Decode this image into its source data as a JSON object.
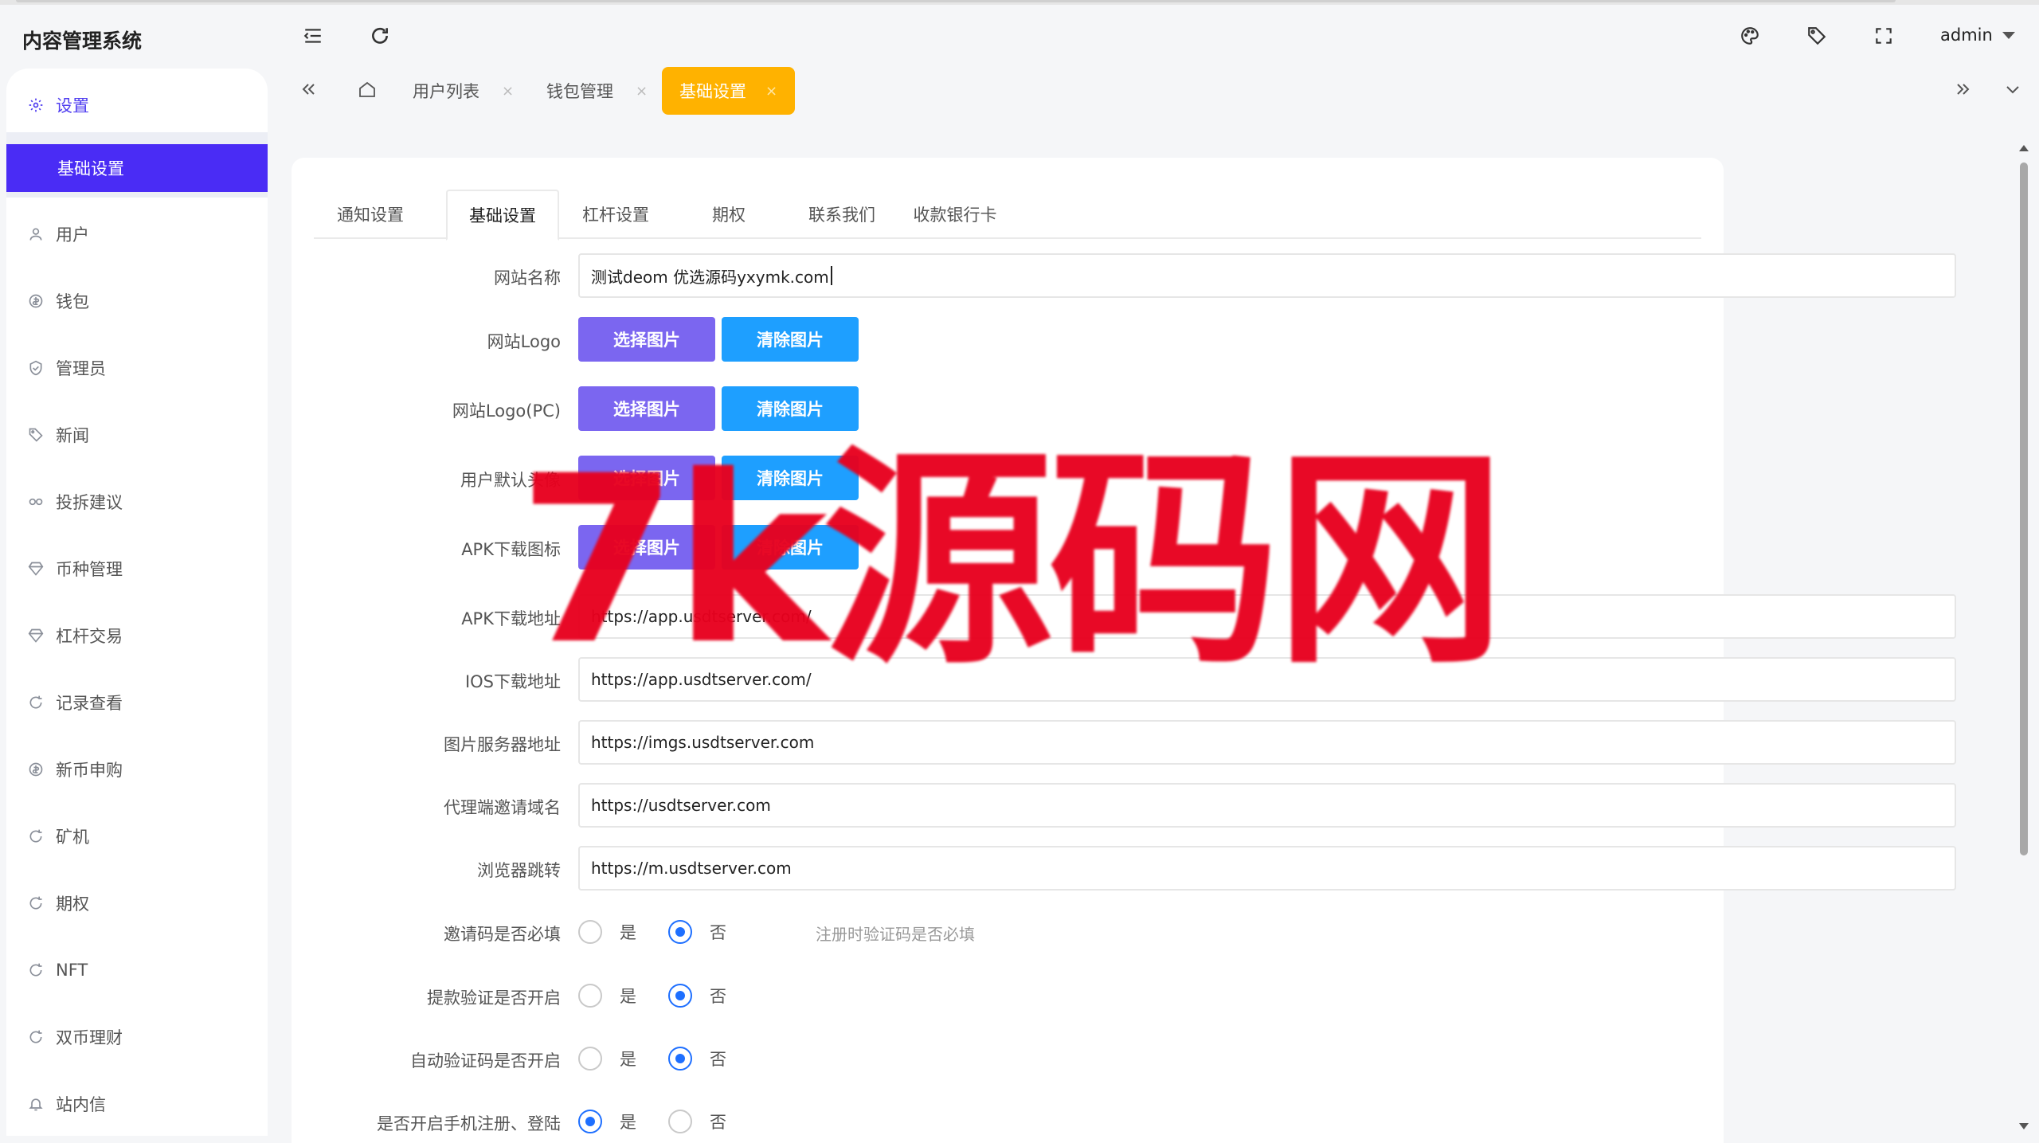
{
  "app": {
    "title": "内容管理系统",
    "user": "admin"
  },
  "sidebar": {
    "items": [
      {
        "label": "设置",
        "icon": "gear-icon"
      },
      {
        "label": "基础设置",
        "icon": ""
      },
      {
        "label": "用户",
        "icon": "user-icon"
      },
      {
        "label": "钱包",
        "icon": "dollar-icon"
      },
      {
        "label": "管理员",
        "icon": "shield-icon"
      },
      {
        "label": "新闻",
        "icon": "tag-icon"
      },
      {
        "label": "投拆建议",
        "icon": "link-icon"
      },
      {
        "label": "币种管理",
        "icon": "diamond-icon"
      },
      {
        "label": "杠杆交易",
        "icon": "diamond-icon"
      },
      {
        "label": "记录查看",
        "icon": "cycle-icon"
      },
      {
        "label": "新币申购",
        "icon": "dollar-icon"
      },
      {
        "label": "矿机",
        "icon": "cycle-icon"
      },
      {
        "label": "期权",
        "icon": "cycle-icon"
      },
      {
        "label": "NFT",
        "icon": "cycle-icon"
      },
      {
        "label": "双币理财",
        "icon": "cycle-icon"
      },
      {
        "label": "站内信",
        "icon": "bell-icon"
      }
    ]
  },
  "tabs": [
    {
      "label": "用户列表",
      "close": "×"
    },
    {
      "label": "钱包管理",
      "close": "×"
    },
    {
      "label": "基础设置",
      "close": "×"
    }
  ],
  "content_tabs": [
    "通知设置",
    "基础设置",
    "杠杆设置",
    "期权",
    "联系我们",
    "收款银行卡"
  ],
  "form": {
    "site_name_label": "网站名称",
    "site_name_value": "测试deom 优选源码yxymk.com",
    "logo_label": "网站Logo",
    "logo_pc_label": "网站Logo(PC)",
    "avatar_label": "用户默认头像",
    "apk_icon_label": "APK下载图标",
    "select_btn": "选择图片",
    "clear_btn": "清除图片",
    "apk_url_label": "APK下载地址",
    "apk_url_value": "https://app.usdtserver.com/",
    "ios_url_label": "IOS下载地址",
    "ios_url_value": "https://app.usdtserver.com/",
    "img_server_label": "图片服务器地址",
    "img_server_value": "https://imgs.usdtserver.com",
    "agent_domain_label": "代理端邀请域名",
    "agent_domain_value": "https://usdtserver.com",
    "browser_jump_label": "浏览器跳转",
    "browser_jump_value": "https://m.usdtserver.com",
    "invite_required_label": "邀请码是否必填",
    "invite_required_hint": "注册时验证码是否必填",
    "withdraw_verify_label": "提款验证是否开启",
    "auto_code_label": "自动验证码是否开启",
    "phone_register_label": "是否开启手机注册、登陆",
    "yes": "是",
    "no": "否",
    "radios": {
      "invite_required": "no",
      "withdraw_verify": "no",
      "auto_code": "no",
      "phone_register": "yes"
    }
  },
  "watermark": "7k源码网"
}
